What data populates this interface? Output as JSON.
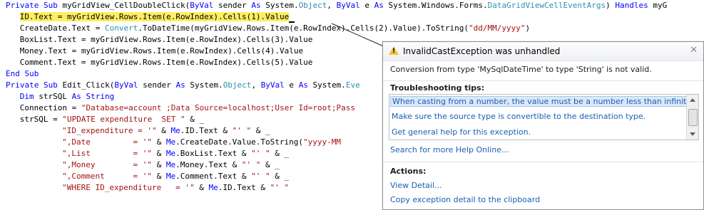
{
  "code_lines": [
    {
      "indent": 0,
      "highlight": false,
      "tokens": [
        {
          "t": "Private Sub",
          "c": "kw"
        },
        {
          "t": " myGridView_CellDoubleClick(",
          "c": ""
        },
        {
          "t": "ByVal",
          "c": "kw"
        },
        {
          "t": " sender ",
          "c": ""
        },
        {
          "t": "As",
          "c": "kw"
        },
        {
          "t": " System.",
          "c": ""
        },
        {
          "t": "Object",
          "c": "ty"
        },
        {
          "t": ", ",
          "c": ""
        },
        {
          "t": "ByVal",
          "c": "kw"
        },
        {
          "t": " e ",
          "c": ""
        },
        {
          "t": "As",
          "c": "kw"
        },
        {
          "t": " System.Windows.Forms.",
          "c": ""
        },
        {
          "t": "DataGridViewCellEventArgs",
          "c": "ty"
        },
        {
          "t": ") ",
          "c": ""
        },
        {
          "t": "Handles",
          "c": "kw"
        },
        {
          "t": " myG",
          "c": ""
        }
      ]
    },
    {
      "indent": 3,
      "highlight": true,
      "tokens": [
        {
          "t": "ID.Text = myGridView.Rows.Item(e.RowIndex).Cells(1).Value",
          "c": ""
        }
      ]
    },
    {
      "indent": 3,
      "highlight": false,
      "tokens": [
        {
          "t": "CreateDate.Text = ",
          "c": ""
        },
        {
          "t": "Convert",
          "c": "ty"
        },
        {
          "t": ".ToDateTime(myGridView.Rows.Item(e.RowIndex).Cells(2).Value).ToString(",
          "c": ""
        },
        {
          "t": "\"dd/MM/yyyy\"",
          "c": "st"
        },
        {
          "t": ")",
          "c": ""
        }
      ]
    },
    {
      "indent": 3,
      "highlight": false,
      "tokens": [
        {
          "t": "BoxList.Text = myGridView.Rows.Item(e.RowIndex).Cells(3).Value",
          "c": ""
        }
      ]
    },
    {
      "indent": 3,
      "highlight": false,
      "tokens": [
        {
          "t": "Money.Text = myGridView.Rows.Item(e.RowIndex).Cells(4).Value",
          "c": ""
        }
      ]
    },
    {
      "indent": 3,
      "highlight": false,
      "tokens": [
        {
          "t": "Comment.Text = myGridView.Rows.Item(e.RowIndex).Cells(5).Value",
          "c": ""
        }
      ]
    },
    {
      "indent": 0,
      "highlight": false,
      "tokens": [
        {
          "t": "End Sub",
          "c": "kw"
        }
      ]
    },
    {
      "indent": 0,
      "highlight": false,
      "tokens": [
        {
          "t": "Private Sub",
          "c": "kw"
        },
        {
          "t": " Edit_Click(",
          "c": ""
        },
        {
          "t": "ByVal",
          "c": "kw"
        },
        {
          "t": " sender ",
          "c": ""
        },
        {
          "t": "As",
          "c": "kw"
        },
        {
          "t": " System.",
          "c": ""
        },
        {
          "t": "Object",
          "c": "ty"
        },
        {
          "t": ", ",
          "c": ""
        },
        {
          "t": "ByVal",
          "c": "kw"
        },
        {
          "t": " e ",
          "c": ""
        },
        {
          "t": "As",
          "c": "kw"
        },
        {
          "t": " System.",
          "c": ""
        },
        {
          "t": "Eve",
          "c": "ty"
        }
      ]
    },
    {
      "indent": 3,
      "highlight": false,
      "tokens": [
        {
          "t": "Dim",
          "c": "kw"
        },
        {
          "t": " strSQL ",
          "c": ""
        },
        {
          "t": "As String",
          "c": "kw"
        }
      ]
    },
    {
      "indent": 3,
      "highlight": false,
      "tokens": [
        {
          "t": "Connection = ",
          "c": ""
        },
        {
          "t": "\"Database=account ;Data Source=localhost;User Id=root;Pass",
          "c": "st"
        }
      ]
    },
    {
      "indent": 3,
      "highlight": false,
      "tokens": [
        {
          "t": "strSQL = ",
          "c": ""
        },
        {
          "t": "\"UPDATE expenditure  SET \"",
          "c": "st"
        },
        {
          "t": " & _",
          "c": ""
        }
      ]
    },
    {
      "indent": 12,
      "highlight": false,
      "tokens": [
        {
          "t": "\"ID_expenditure = '\"",
          "c": "st"
        },
        {
          "t": " & ",
          "c": ""
        },
        {
          "t": "Me",
          "c": "kw"
        },
        {
          "t": ".ID.Text & ",
          "c": ""
        },
        {
          "t": "\"' \"",
          "c": "st"
        },
        {
          "t": " & _",
          "c": ""
        }
      ]
    },
    {
      "indent": 12,
      "highlight": false,
      "tokens": [
        {
          "t": "\",Date         = '\"",
          "c": "st"
        },
        {
          "t": " & ",
          "c": ""
        },
        {
          "t": "Me",
          "c": "kw"
        },
        {
          "t": ".CreateDate.Value.ToString(",
          "c": ""
        },
        {
          "t": "\"yyyy-MM",
          "c": "st"
        }
      ]
    },
    {
      "indent": 12,
      "highlight": false,
      "tokens": [
        {
          "t": "\",List         = '\"",
          "c": "st"
        },
        {
          "t": " & ",
          "c": ""
        },
        {
          "t": "Me",
          "c": "kw"
        },
        {
          "t": ".BoxList.Text & ",
          "c": ""
        },
        {
          "t": "\"' \"",
          "c": "st"
        },
        {
          "t": " & _",
          "c": ""
        }
      ]
    },
    {
      "indent": 12,
      "highlight": false,
      "tokens": [
        {
          "t": "\",Money        = '\"",
          "c": "st"
        },
        {
          "t": " & ",
          "c": ""
        },
        {
          "t": "Me",
          "c": "kw"
        },
        {
          "t": ".Money.Text & ",
          "c": ""
        },
        {
          "t": "\"' \"",
          "c": "st"
        },
        {
          "t": " & _",
          "c": ""
        }
      ]
    },
    {
      "indent": 12,
      "highlight": false,
      "tokens": [
        {
          "t": "\",Comment      = '\"",
          "c": "st"
        },
        {
          "t": " & ",
          "c": ""
        },
        {
          "t": "Me",
          "c": "kw"
        },
        {
          "t": ".Comment.Text & ",
          "c": ""
        },
        {
          "t": "\"' \"",
          "c": "st"
        },
        {
          "t": " & _",
          "c": ""
        }
      ]
    },
    {
      "indent": 12,
      "highlight": false,
      "tokens": [
        {
          "t": "\"WHERE ID_expenditure   = '\"",
          "c": "st"
        },
        {
          "t": " & ",
          "c": ""
        },
        {
          "t": "Me",
          "c": "kw"
        },
        {
          "t": ".ID.Text & ",
          "c": ""
        },
        {
          "t": "\"' \"",
          "c": "st"
        }
      ]
    }
  ],
  "assistant": {
    "icon": "warning-icon",
    "title": "InvalidCastException was unhandled",
    "close_icon": "close-icon",
    "message": "Conversion from type 'MySqlDateTime' to type 'String' is not valid.",
    "tips_heading": "Troubleshooting tips:",
    "tips": [
      "When casting from a number, the value must be a number less than infinity.",
      "Make sure the source type is convertible to the destination type.",
      "Get general help for this exception."
    ],
    "search_link": "Search for more Help Online...",
    "actions_heading": "Actions:",
    "actions": [
      "View Detail...",
      "Copy exception detail to the clipboard"
    ]
  },
  "colors": {
    "keyword": "#0000ff",
    "type": "#2b91af",
    "string": "#a31515",
    "highlight": "#ffee62",
    "link": "#1a5fb4",
    "warning": "#f2c12e"
  }
}
